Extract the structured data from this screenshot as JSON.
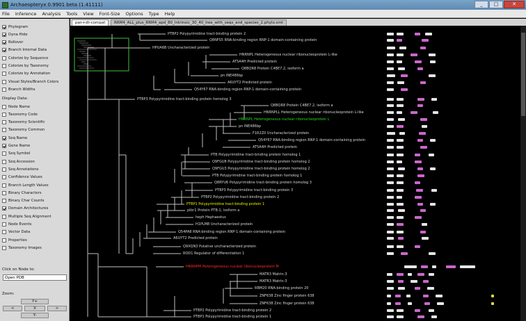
{
  "window": {
    "title": "Archaeopteryx 0.9901 beta (1.41111)"
  },
  "menu": [
    "File",
    "Inference",
    "Analysis",
    "Tools",
    "View",
    "Font-Size",
    "Options",
    "Type",
    "Help"
  ],
  "left_panel": {
    "options_top": [
      {
        "label": "Phylogram",
        "checked": true
      },
      {
        "label": "Dyna Hide",
        "checked": true
      },
      {
        "label": "Rollover",
        "checked": true
      },
      {
        "label": "Branch Internal Data",
        "checked": true
      },
      {
        "label": "Colorize by Sequence",
        "checked": false
      },
      {
        "label": "Colorize by Taxonomy",
        "checked": false
      },
      {
        "label": "Colorize by Annotation",
        "checked": false
      },
      {
        "label": "Visual Styles/Branch Colors",
        "checked": false
      },
      {
        "label": "Branch Widths",
        "checked": false
      }
    ],
    "display_data_heading": "Display Data:",
    "options_data": [
      {
        "label": "Node Name",
        "checked": false
      },
      {
        "label": "Taxonomy Code",
        "checked": false
      },
      {
        "label": "Taxonomy Scientific",
        "checked": false
      },
      {
        "label": "Taxonomy Common",
        "checked": false
      },
      {
        "label": "Seq Name",
        "checked": true
      },
      {
        "label": "Gene Name",
        "checked": true
      },
      {
        "label": "Seq Symbol",
        "checked": false
      },
      {
        "label": "Seq Accession",
        "checked": false
      },
      {
        "label": "Seq Annotations",
        "checked": false
      },
      {
        "label": "Confidence Values",
        "checked": false
      },
      {
        "label": "Branch Length Values",
        "checked": false
      },
      {
        "label": "Binary Characters",
        "checked": false
      },
      {
        "label": "Binary Char Counts",
        "checked": false
      },
      {
        "label": "Domain Architectures",
        "checked": true
      },
      {
        "label": "Multiple Seq Alignment",
        "checked": false
      },
      {
        "label": "Node Events",
        "checked": false
      },
      {
        "label": "Vector Data",
        "checked": false
      },
      {
        "label": "Properties",
        "checked": false
      },
      {
        "label": "Taxonomy Images",
        "checked": false
      }
    ],
    "click_on_node_label": "Click on Node to:",
    "click_action_value": "Open PDB",
    "zoom_label": "Zoom:",
    "zoom_buttons": [
      "Y+",
      "<",
      "X",
      ">",
      "Y-"
    ]
  },
  "tabs": [
    {
      "label": "pan+dt-compat",
      "active": true
    },
    {
      "label": "RRM4_ALL_plus_RRM4_apd_80_Intrinsic_30_40_Iree_with_seqs_and_species_2.phylo.xml",
      "active": false
    }
  ],
  "tree": {
    "nodes": [
      {
        "text": "PTBP2 Polypyrimidine tract-binding protein 2",
        "color": "normal"
      },
      {
        "text": "Q8NFS5 RNA-binding region RNP-1 domain-containing protein",
        "color": "normal"
      },
      {
        "text": "HPUA6B Uncharacterized protein",
        "color": "normal"
      },
      {
        "text": "HNRNPL Heterogeneous nuclear ribonucleoprotein L-like",
        "color": "normal"
      },
      {
        "text": "AT5A4H Predicted protein",
        "color": "normal"
      },
      {
        "text": "Q8BQR8 Protein C4BE7.2, isoform a",
        "color": "normal"
      },
      {
        "text": "pn INE486bp",
        "color": "normal"
      },
      {
        "text": "A6UYT2 Predicted protein",
        "color": "normal"
      },
      {
        "text": "Q54Y67 RNA-binding region RNP-1 domain-containing protein",
        "color": "normal"
      },
      {
        "text": "PTBP3 Polypyrimidine tract-binding protein homolog 3",
        "color": "normal"
      },
      {
        "text": "Q8BQR8 Protein C4BE7.2, isoform a",
        "color": "normal"
      },
      {
        "text": "HNRNPLL Heterogeneous nuclear ribonucleoprotein L-like",
        "color": "normal"
      },
      {
        "text": "HNRNPL Heterogeneous nuclear ribonucleoprotein L",
        "color": "green"
      },
      {
        "text": "pn INE486bp",
        "color": "normal"
      },
      {
        "text": "F1R2Z0 Uncharacterized protein",
        "color": "normal"
      },
      {
        "text": "Q54Y67 RNA-binding region RNP-1 domain-containing protein",
        "color": "normal"
      },
      {
        "text": "AT5A4H Predicted protein",
        "color": "normal"
      },
      {
        "text": "PTB Polypyrimidine tract-binding protein homolog 1",
        "color": "normal"
      },
      {
        "text": "Q9FGU8 Polypyrimidine tract-binding protein homolog 2",
        "color": "normal"
      },
      {
        "text": "Q9FGU3 Polypyrimidine tract-binding protein homolog 2",
        "color": "normal"
      },
      {
        "text": "PTB Polypyrimidine tract-binding protein homolog 1",
        "color": "normal"
      },
      {
        "text": "Q8RYU6 Polypyrimidine tract-binding protein homolog 3",
        "color": "normal"
      },
      {
        "text": "PTBP3 Polypyrimidine tract-binding protein 3",
        "color": "normal"
      },
      {
        "text": "PTBP2 Polypyrimidine tract-binding protein 2",
        "color": "normal"
      },
      {
        "text": "PTBP1 Polypyrimidine tract-binding protein 1",
        "color": "yellow"
      },
      {
        "text": "ptbr1 Protein PTB-1, isoform a",
        "color": "normal"
      },
      {
        "text": "heph Hephaestus",
        "color": "normal"
      },
      {
        "text": "H1PLM8 Uncharacterized protein",
        "color": "normal"
      },
      {
        "text": "Q54PA8 RNA-binding region RNP-1 domain-containing protein",
        "color": "normal"
      },
      {
        "text": "A6UYT2 Predicted protein",
        "color": "normal"
      },
      {
        "text": "Q9XQN3 Putative uncharacterized protein",
        "color": "normal"
      },
      {
        "text": "ROD1 Regulator of differentiation 1",
        "color": "normal"
      },
      {
        "text": "HNRNPM Heterogeneous nuclear ribonucleoprotein M",
        "color": "red"
      },
      {
        "text": "MATR3 Matrin-3",
        "color": "normal"
      },
      {
        "text": "MATR3 Matrin-3",
        "color": "normal"
      },
      {
        "text": "RBM20 RNA-binding protein 20",
        "color": "normal"
      },
      {
        "text": "ZNF638 Zinc finger protein 638",
        "color": "normal"
      },
      {
        "text": "ZNF638 Zinc finger protein 638",
        "color": "normal"
      },
      {
        "text": "PTBP2 Polypyrimidine tract-binding protein 2",
        "color": "normal"
      },
      {
        "text": "PTBP1 Polypyrimidine tract-binding protein 1",
        "color": "normal"
      }
    ]
  },
  "colors": {
    "background": "#000000",
    "branch": "#bfbfbf",
    "label": "#d8d8d8",
    "highlight_green": "#28d628",
    "highlight_yellow": "#f0f000",
    "highlight_red": "#ff2a2a",
    "domain_rrm": "#e6e6e6",
    "domain_other": "#cc66cc",
    "domain_extra": "#e6d44a",
    "overview_box": "#3fbf3f"
  }
}
